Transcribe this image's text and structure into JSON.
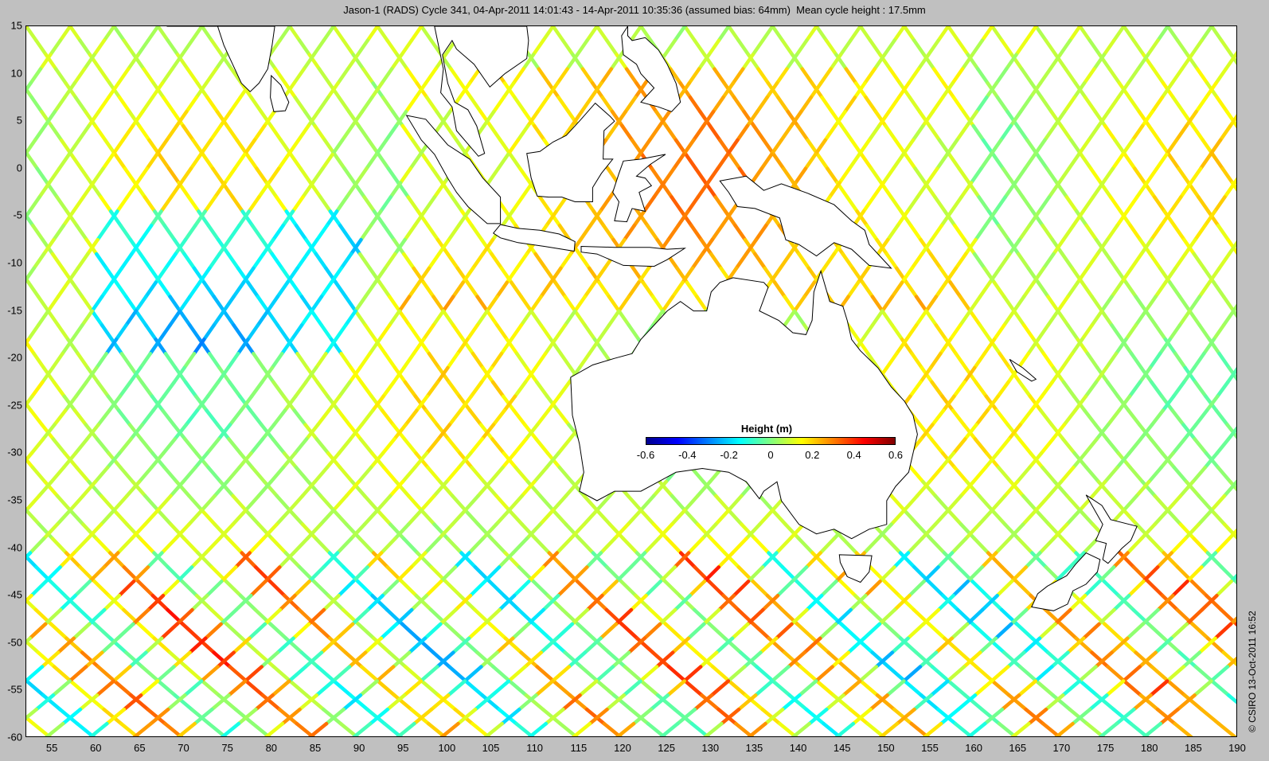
{
  "title": "Jason-1 (RADS) Cycle 341, 04-Apr-2011 14:01:43 - 14-Apr-2011 10:35:36 (assumed bias: 64mm)  Mean cycle height : 17.5mm",
  "credit": "© CSIRO 13-Oct-2011 16:52",
  "axes": {
    "x_range": [
      52,
      190
    ],
    "y_range": [
      -60,
      15
    ],
    "x_ticks": [
      "55",
      "60",
      "65",
      "70",
      "75",
      "80",
      "85",
      "90",
      "95",
      "100",
      "105",
      "110",
      "115",
      "120",
      "125",
      "130",
      "135",
      "140",
      "145",
      "150",
      "155",
      "160",
      "165",
      "170",
      "175",
      "180",
      "185",
      "190"
    ],
    "y_ticks": [
      "15",
      "10",
      "5",
      "0",
      "-5",
      "-10",
      "-15",
      "-20",
      "-25",
      "-30",
      "-35",
      "-40",
      "-45",
      "-50",
      "-55",
      "-60"
    ]
  },
  "colorbar": {
    "title": "Height (m)",
    "range": [
      -0.6,
      0.6
    ],
    "tick_labels": [
      "-0.6",
      "-0.4",
      "-0.2",
      "0",
      "0.2",
      "0.4",
      "0.6"
    ],
    "colormap": [
      "#00008f",
      "#0000ff",
      "#0080ff",
      "#00ffff",
      "#80ff80",
      "#ffff00",
      "#ff8000",
      "#ff0000",
      "#800000"
    ]
  },
  "colors": {
    "background": "#c0c0c0",
    "ocean": "#ffffff",
    "coast": "#000000"
  }
}
